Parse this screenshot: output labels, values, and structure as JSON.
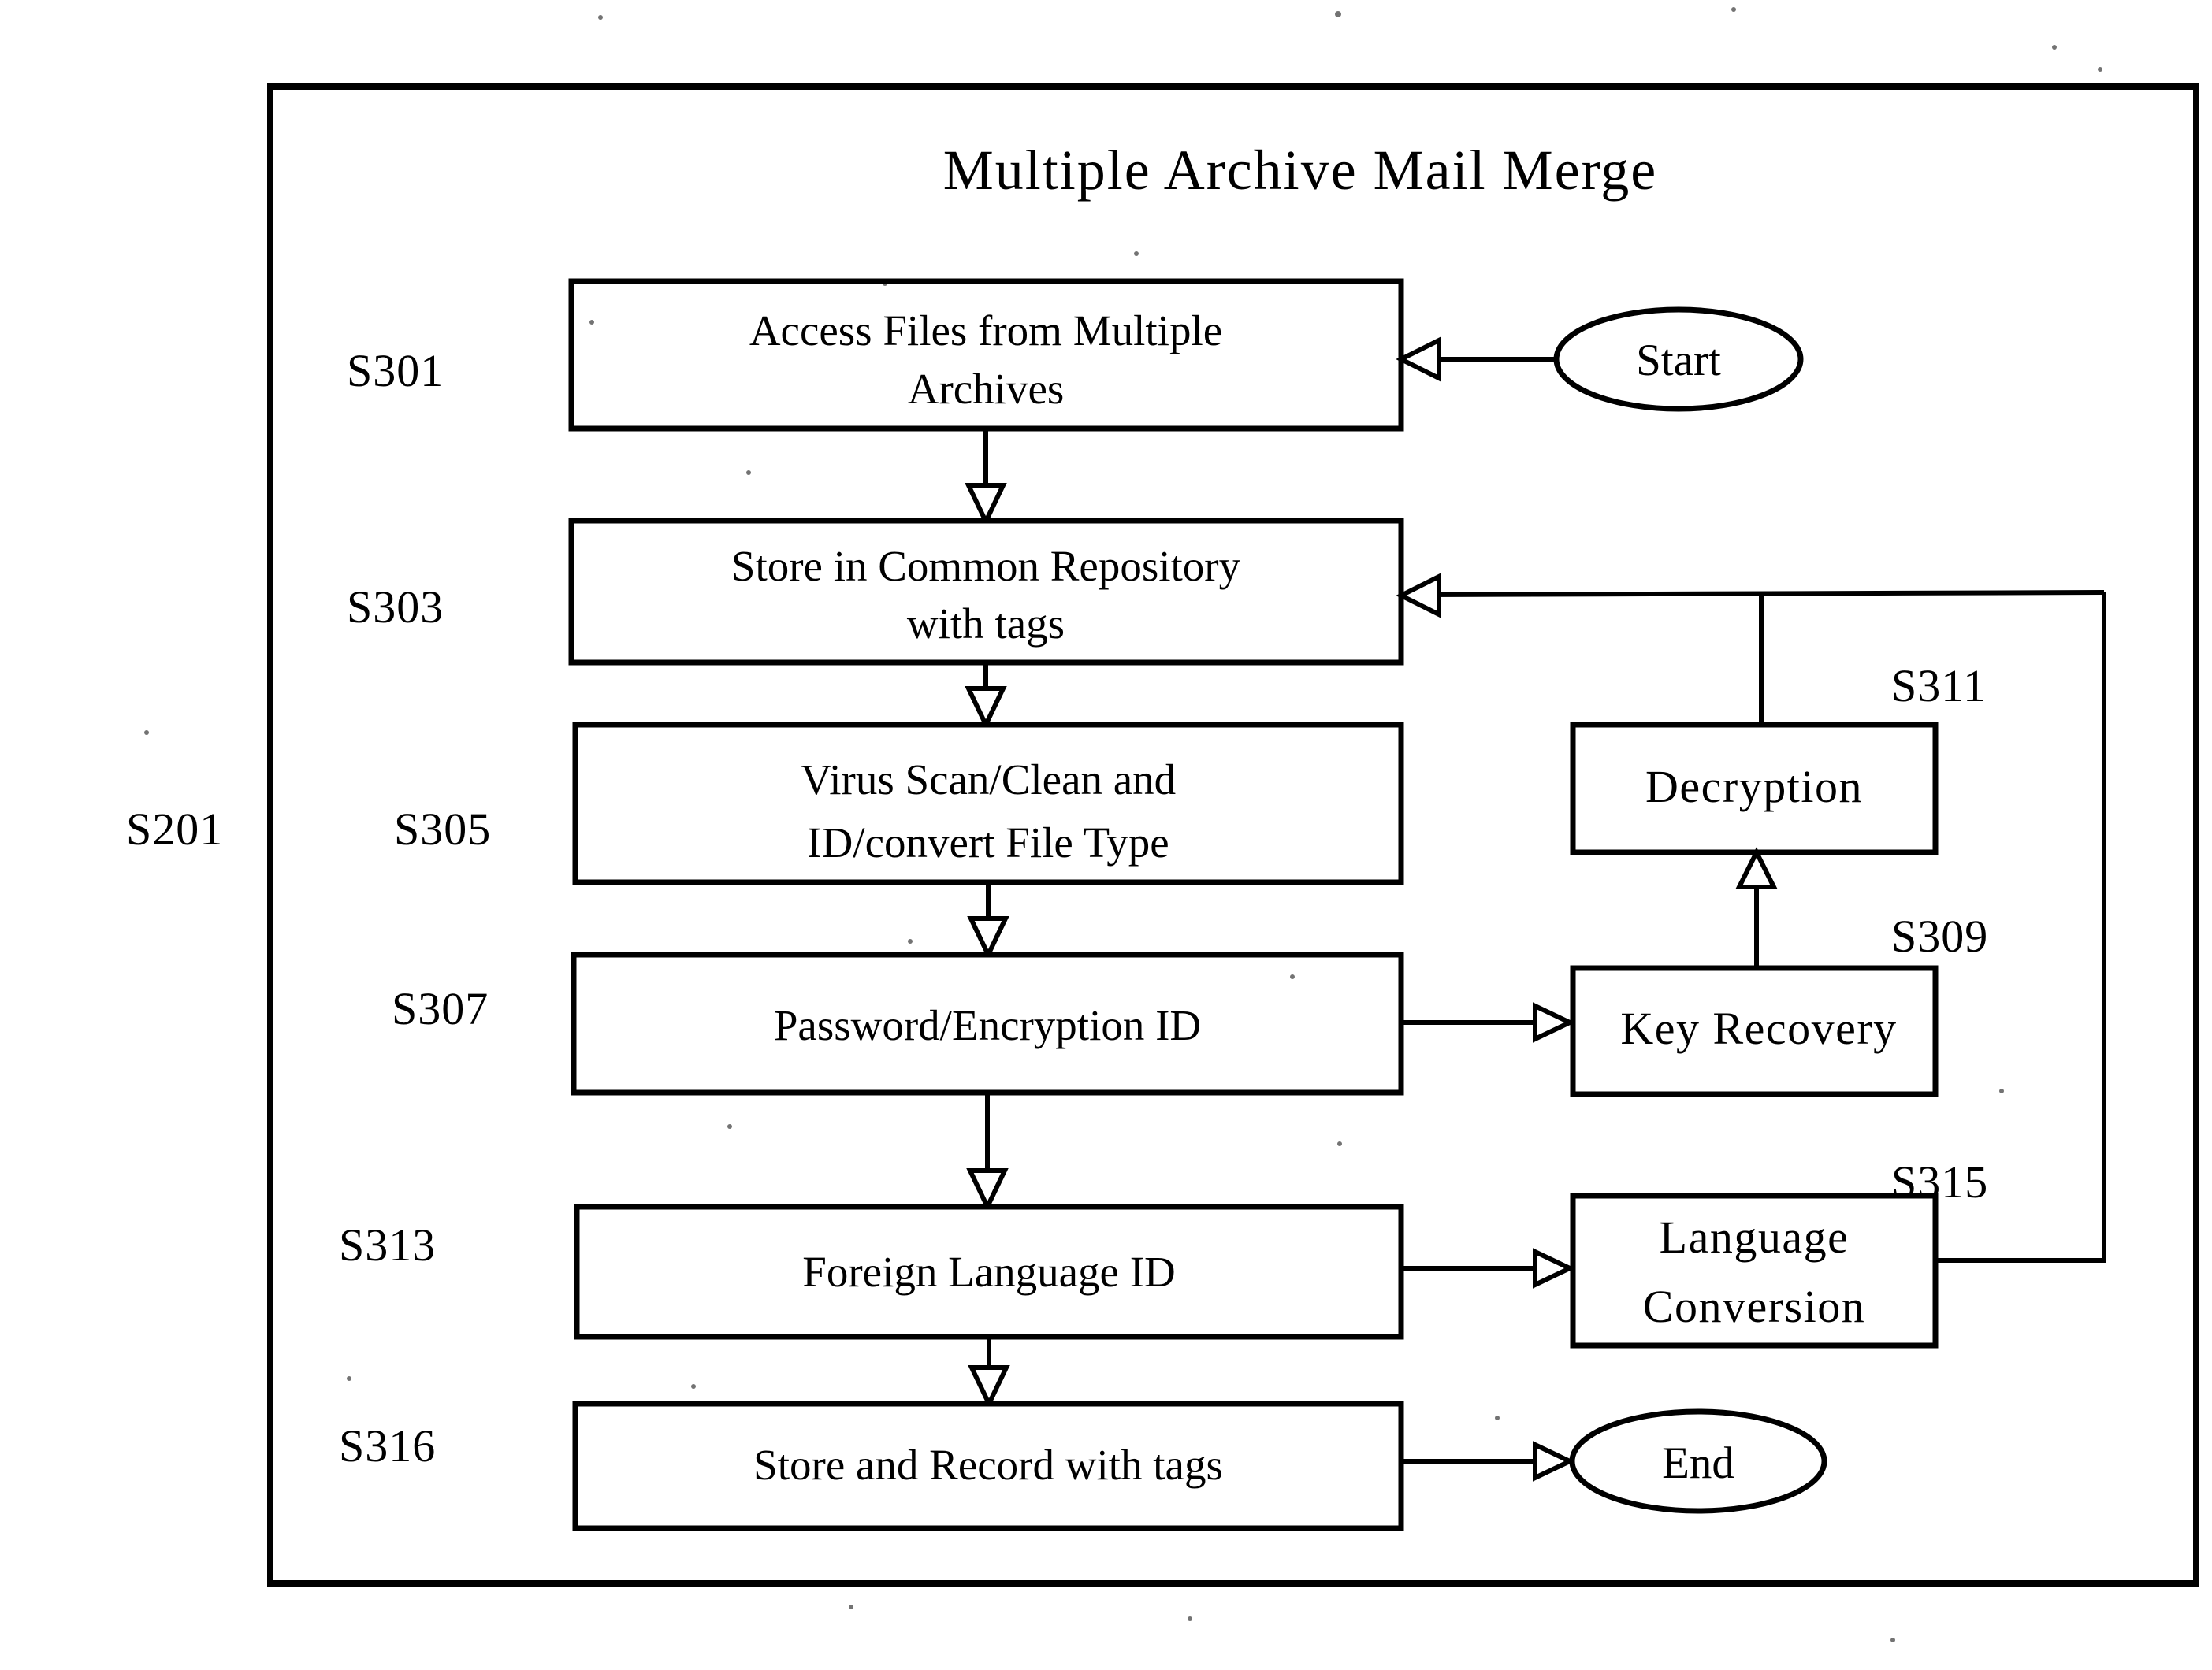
{
  "figure": {
    "title": "Multiple Archive Mail Merge",
    "outer_step_tag": "S201",
    "border_color": "#000000",
    "background_color": "#ffffff"
  },
  "terminators": [
    {
      "id": "start",
      "label": "Start"
    },
    {
      "id": "end",
      "label": "End"
    }
  ],
  "steps": [
    {
      "tag": "S301",
      "label_line1": "Access Files from Multiple",
      "label_line2": "Archives",
      "column": "main"
    },
    {
      "tag": "S303",
      "label_line1": "Store in Common Repository",
      "label_line2": "with tags",
      "column": "main"
    },
    {
      "tag": "S305",
      "label_line1": "Virus Scan/Clean and",
      "label_line2": "ID/convert File Type",
      "column": "main"
    },
    {
      "tag": "S307",
      "label_line1": "Password/Encryption ID",
      "label_line2": "",
      "column": "main"
    },
    {
      "tag": "S313",
      "label_line1": "Foreign Language ID",
      "label_line2": "",
      "column": "main"
    },
    {
      "tag": "S316",
      "label_line1": "Store and Record with tags",
      "label_line2": "",
      "column": "main"
    },
    {
      "tag": "S311",
      "label_line1": "Decryption",
      "label_line2": "",
      "column": "side"
    },
    {
      "tag": "S309",
      "label_line1": "Key Recovery",
      "label_line2": "",
      "column": "side"
    },
    {
      "tag": "S315",
      "label_line1": "Language",
      "label_line2": "Conversion",
      "column": "side"
    }
  ],
  "connections": [
    {
      "from": "start",
      "to": "S301",
      "kind": "arrow-left"
    },
    {
      "from": "S301",
      "to": "S303",
      "kind": "arrow-down"
    },
    {
      "from": "S303",
      "to": "S305",
      "kind": "arrow-down"
    },
    {
      "from": "S305",
      "to": "S307",
      "kind": "arrow-down"
    },
    {
      "from": "S307",
      "to": "S309",
      "kind": "arrow-right"
    },
    {
      "from": "S309",
      "to": "S311",
      "kind": "arrow-up"
    },
    {
      "from": "S311",
      "to": "S303",
      "kind": "feedback-left"
    },
    {
      "from": "S307",
      "to": "S313",
      "kind": "arrow-down"
    },
    {
      "from": "S313",
      "to": "S315",
      "kind": "arrow-right"
    },
    {
      "from": "S315",
      "to": "S303",
      "kind": "feedback-right-up-left"
    },
    {
      "from": "S313",
      "to": "S316",
      "kind": "arrow-down"
    },
    {
      "from": "S316",
      "to": "end",
      "kind": "arrow-right"
    }
  ]
}
